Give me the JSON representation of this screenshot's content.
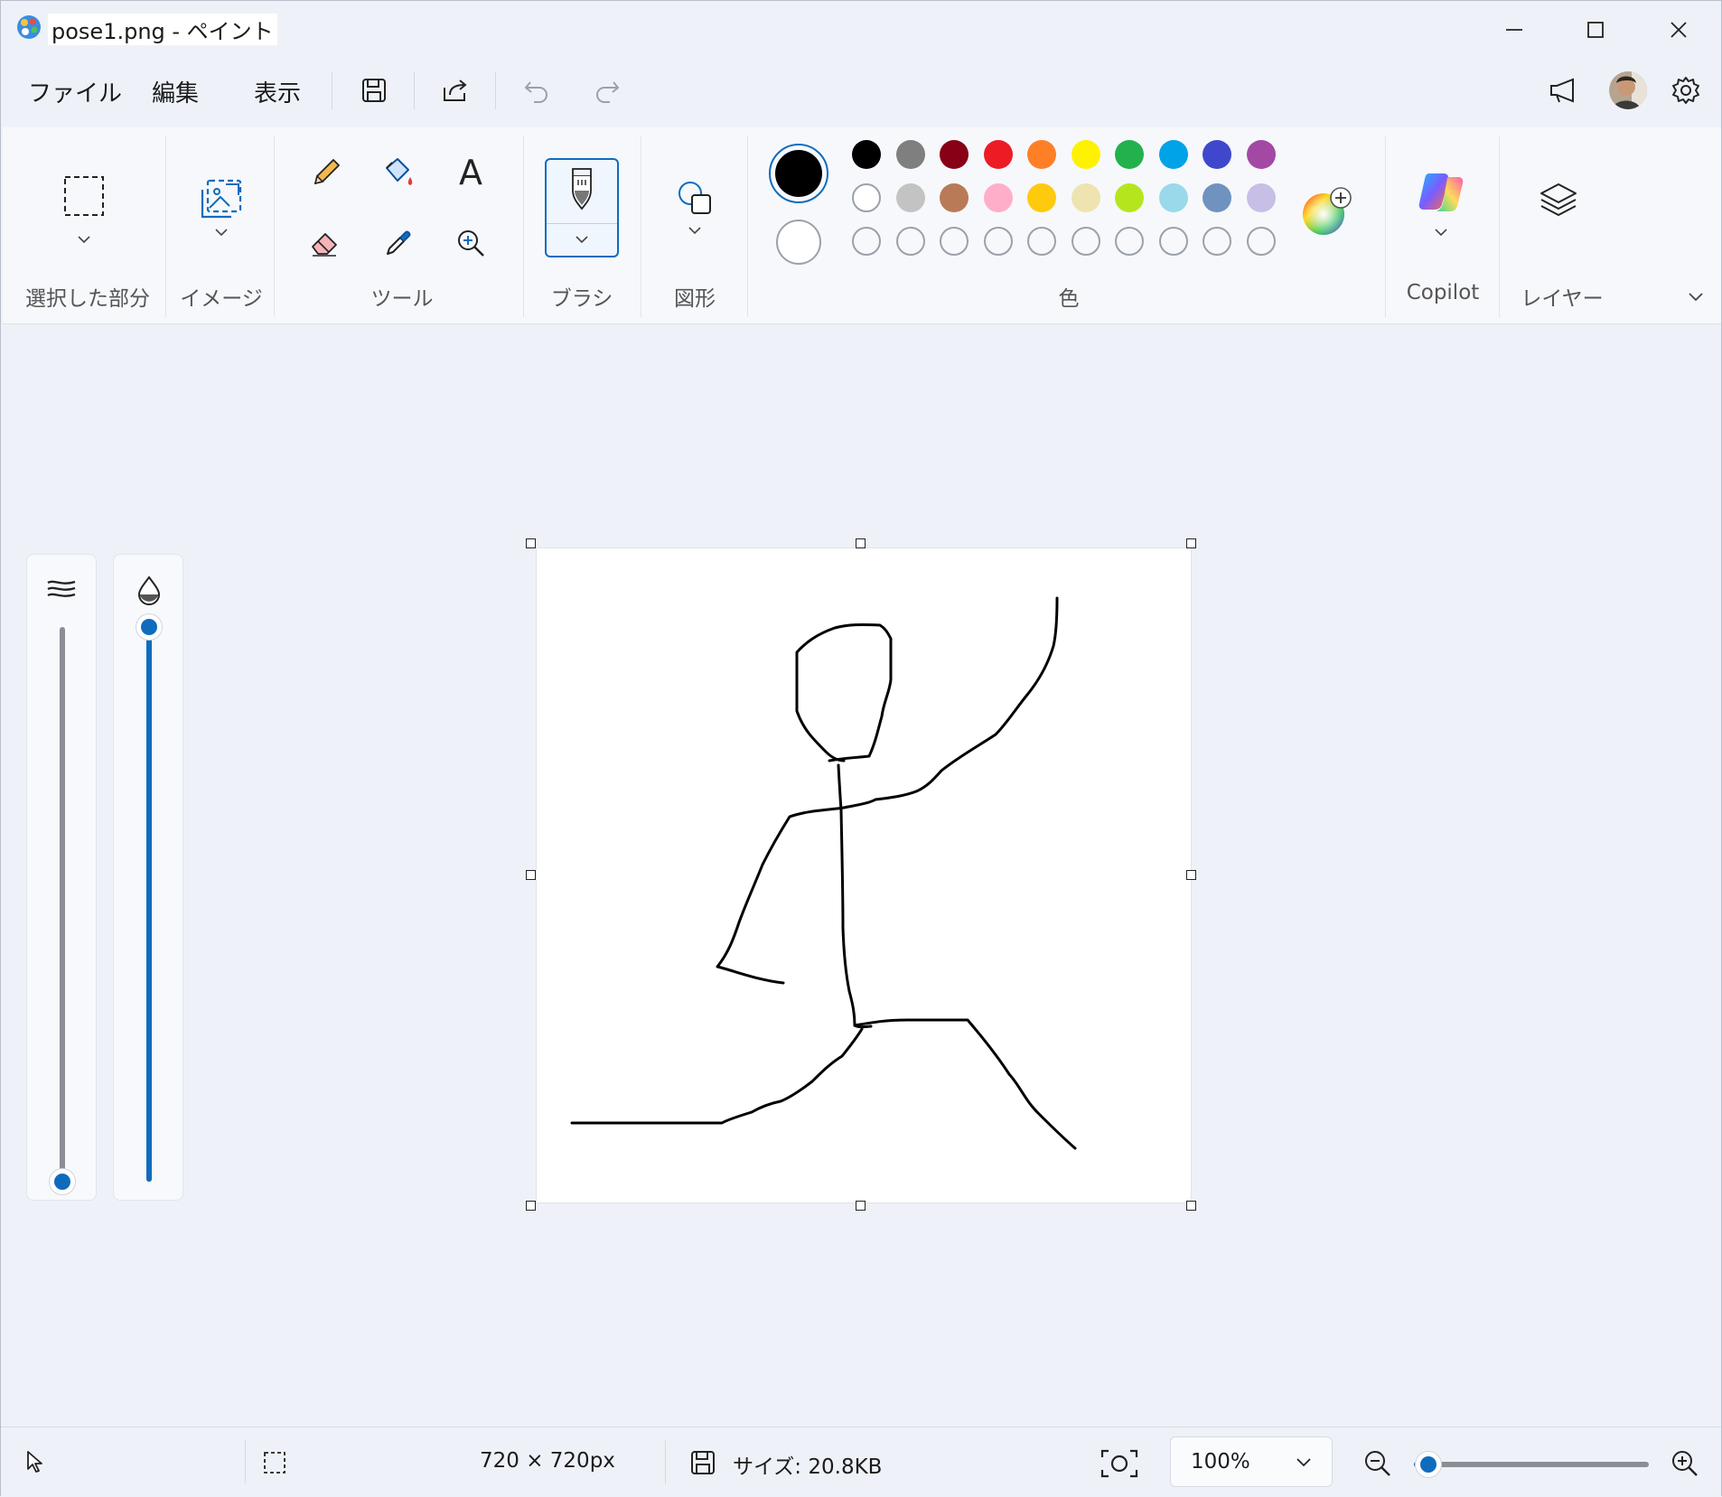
{
  "window": {
    "title": "pose1.png - ペイント"
  },
  "menu": {
    "file": "ファイル",
    "edit": "編集",
    "view": "表示"
  },
  "ribbon": {
    "selection_label": "選択した部分",
    "image_label": "イメージ",
    "tools_label": "ツール",
    "brush_label": "ブラシ",
    "shapes_label": "図形",
    "colors_label": "色",
    "copilot_label": "Copilot",
    "layers_label": "レイヤー",
    "text_tool_glyph": "A"
  },
  "colors": {
    "primary": "#000000",
    "secondary": "#ffffff",
    "row1": [
      "#000000",
      "#7f7f7f",
      "#880015",
      "#ed1c24",
      "#ff7f27",
      "#fff200",
      "#22b14c",
      "#00a2e8",
      "#3f48cc",
      "#a349a4"
    ],
    "row2": [
      "#ffffff",
      "#c3c3c3",
      "#b97a57",
      "#ffaec9",
      "#ffc90e",
      "#efe4b0",
      "#b5e61d",
      "#99d9ea",
      "#7092be",
      "#c8bfe7"
    ],
    "row3_empty_count": 10
  },
  "sliders": {
    "size_level": 0.0,
    "opacity_level": 1.0
  },
  "status": {
    "dimensions": "720 × 720px",
    "file_size": "サイズ: 20.8KB",
    "zoom": "100%",
    "zoom_slider_level": 0.06
  },
  "icons": [
    "paint-app-icon",
    "minimize-icon",
    "maximize-icon",
    "close-icon",
    "save-icon",
    "share-icon",
    "undo-icon",
    "redo-icon",
    "announcement-icon",
    "avatar",
    "settings-icon",
    "selection-icon",
    "image-icon",
    "pencil-icon",
    "fill-icon",
    "text-icon",
    "eraser-icon",
    "color-picker-icon",
    "magnifier-icon",
    "brush-icon",
    "shapes-icon",
    "edit-colors-icon",
    "copilot-icon",
    "layers-icon",
    "pointer-icon",
    "selection-status-icon",
    "save-status-icon",
    "fit-screen-icon",
    "zoom-out-icon",
    "zoom-in-icon"
  ]
}
